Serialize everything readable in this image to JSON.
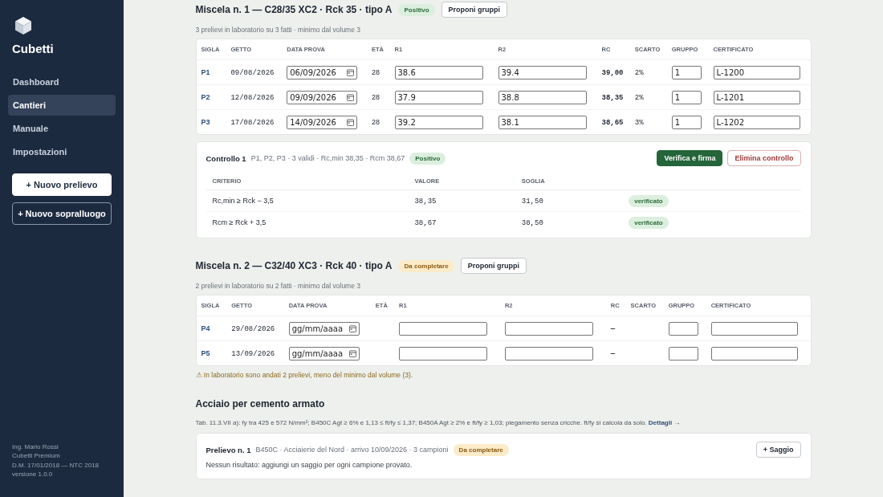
{
  "sidebar": {
    "brand": "Cubetti",
    "items": [
      {
        "label": "Dashboard",
        "selected": false
      },
      {
        "label": "Cantieri",
        "selected": true
      },
      {
        "label": "Manuale",
        "selected": false
      },
      {
        "label": "Impostazioni",
        "selected": false
      }
    ],
    "actions": [
      {
        "label": "+ Nuovo prelievo",
        "kind": "primary"
      },
      {
        "label": "+ Nuovo sopralluogo",
        "kind": "outline"
      }
    ],
    "footer": [
      "Ing. Mario Rossi",
      "Cubetti Premium",
      "D.M. 17/01/2018 — NTC 2018",
      "versione 1.0.0"
    ]
  },
  "mixtures": [
    {
      "title": "Miscela n. 1 — C28/35 XC2 · Rck 35 · tipo A",
      "status": {
        "label": "Positivo",
        "kind": "positive"
      },
      "button": "Proponi gruppi",
      "subtitle": "3 prelievi in laboratorio su 3 fatti · minimo dal volume 3",
      "columns": [
        "SIGLA",
        "GETTO",
        "DATA PROVA",
        "ETÀ",
        "R1",
        "R2",
        "RC",
        "SCARTO",
        "GRUPPO",
        "CERTIFICATO"
      ],
      "rows": [
        {
          "sigla": "P1",
          "getto": "09/08/2026",
          "data_prova": {
            "value": "06/09/2026"
          },
          "eta": "28",
          "r1": "38.6",
          "r2": "39.4",
          "rc": "39,00",
          "scarto": "2%",
          "gruppo": "1",
          "certificato": "L-1200"
        },
        {
          "sigla": "P2",
          "getto": "12/08/2026",
          "data_prova": {
            "value": "09/09/2026"
          },
          "eta": "28",
          "r1": "37.9",
          "r2": "38.8",
          "rc": "38,35",
          "scarto": "2%",
          "gruppo": "1",
          "certificato": "L-1201"
        },
        {
          "sigla": "P3",
          "getto": "17/08/2026",
          "data_prova": {
            "value": "14/09/2026"
          },
          "eta": "28",
          "r1": "39.2",
          "r2": "38.1",
          "rc": "38,65",
          "scarto": "3%",
          "gruppo": "1",
          "certificato": "L-1202"
        }
      ],
      "control": {
        "title": "Controllo 1",
        "summary": "P1, P2, P3 · 3 validi · Rc,min 38,35 · Rcm 38,67",
        "status": {
          "label": "Positivo",
          "kind": "positive"
        },
        "buttons": [
          {
            "label": "Verifica e firma",
            "kind": "primary"
          },
          {
            "label": "Elimina controllo",
            "kind": "danger"
          }
        ],
        "columns": [
          "CRITERIO",
          "VALORE",
          "SOGLIA"
        ],
        "rows": [
          {
            "criterio": "Rc,min ≥ Rck − 3,5",
            "valore": "38,35",
            "soglia": "31,50",
            "esito": "verificato"
          },
          {
            "criterio": "Rcm ≥ Rck + 3,5",
            "valore": "38,67",
            "soglia": "38,50",
            "esito": "verificato"
          }
        ]
      }
    },
    {
      "title": "Miscela n. 2 — C32/40 XC3 · Rck 40 · tipo A",
      "status": {
        "label": "Da completare",
        "kind": "pending"
      },
      "button": "Proponi gruppi",
      "subtitle": "2 prelievi in laboratorio su 2 fatti · minimo dal volume 3",
      "columns": [
        "SIGLA",
        "GETTO",
        "DATA PROVA",
        "ETÀ",
        "R1",
        "R2",
        "RC",
        "SCARTO",
        "GRUPPO",
        "CERTIFICATO"
      ],
      "rows": [
        {
          "sigla": "P4",
          "getto": "29/08/2026",
          "data_prova": {
            "placeholder": "gg/mm/aaaa"
          },
          "rc": "—"
        },
        {
          "sigla": "P5",
          "getto": "13/09/2026",
          "data_prova": {
            "placeholder": "gg/mm/aaaa"
          },
          "rc": "—"
        }
      ],
      "warning": "⚠ In laboratorio sono andati 2 prelievi, meno del minimo dal volume (3)."
    }
  ],
  "steel": {
    "title": "Acciaio per cemento armato",
    "note": "Tab. 11.3.VII a): fy tra 425 e 572 N/mm²; B450C Agt ≥ 6% e 1,13 ≤ ft/fy ≤ 1,37; B450A Agt ≥ 2% e ft/fy ≥ 1,03; piegamento senza cricche. ft/fy si calcola da solo.",
    "link": "Dettagli →",
    "samples": [
      {
        "title": "Prelievo n. 1",
        "info": "B450C · Acciaierie del Nord · arrivo 10/09/2026 · 3 campioni",
        "status": {
          "label": "Da completare",
          "kind": "pending"
        },
        "button": "+ Saggio",
        "empty": "Nessun risultato: aggiungi un saggio per ogni campione provato."
      }
    ]
  }
}
